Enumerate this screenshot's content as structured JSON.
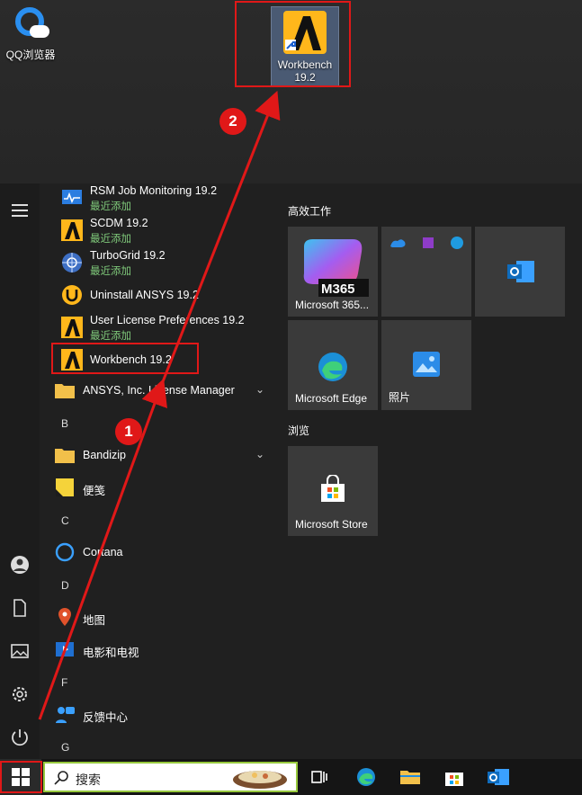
{
  "desktop": {
    "qq_label": "QQ浏览器",
    "workbench_label_line1": "Workbench",
    "workbench_label_line2": "19.2"
  },
  "annotations": {
    "badge1": "1",
    "badge2": "2"
  },
  "app_list": [
    {
      "name": "RSM Job Monitoring 19.2",
      "sub": "最近添加",
      "icon": "rsm-monitor-icon"
    },
    {
      "name": "SCDM 19.2",
      "sub": "最近添加",
      "icon": "ansys-logo-icon"
    },
    {
      "name": "TurboGrid 19.2",
      "sub": "最近添加",
      "icon": "turbogrid-icon"
    },
    {
      "name": "Uninstall ANSYS 19.2",
      "sub": "",
      "icon": "uninstall-icon"
    },
    {
      "name": "User License Preferences 19.2",
      "sub": "最近添加",
      "icon": "ansys-logo-icon"
    },
    {
      "name": "Workbench 19.2",
      "sub": "",
      "icon": "ansys-logo-icon"
    },
    {
      "name": "ANSYS, Inc. License Manager",
      "sub": "",
      "icon": "folder-icon"
    }
  ],
  "groups": [
    {
      "letter": "B",
      "items": [
        "Bandizip",
        "便笺"
      ]
    },
    {
      "letter": "C",
      "items": [
        "Cortana"
      ]
    },
    {
      "letter": "D",
      "items": [
        "地图",
        "电影和电视"
      ]
    },
    {
      "letter": "F",
      "items": [
        "反馈中心"
      ]
    },
    {
      "letter": "G",
      "items": []
    }
  ],
  "tiles": {
    "section1": "高效工作",
    "section2": "浏览",
    "m365_label": "Microsoft 365...",
    "m365_text": "M365",
    "edge_label": "Microsoft Edge",
    "photos_label": "照片",
    "store_label": "Microsoft Store"
  },
  "taskbar": {
    "search_placeholder": "搜索"
  },
  "colors": {
    "accent_red": "#e01818",
    "recent_green": "#7fc97a",
    "ansys_yellow": "#ffb71b"
  }
}
